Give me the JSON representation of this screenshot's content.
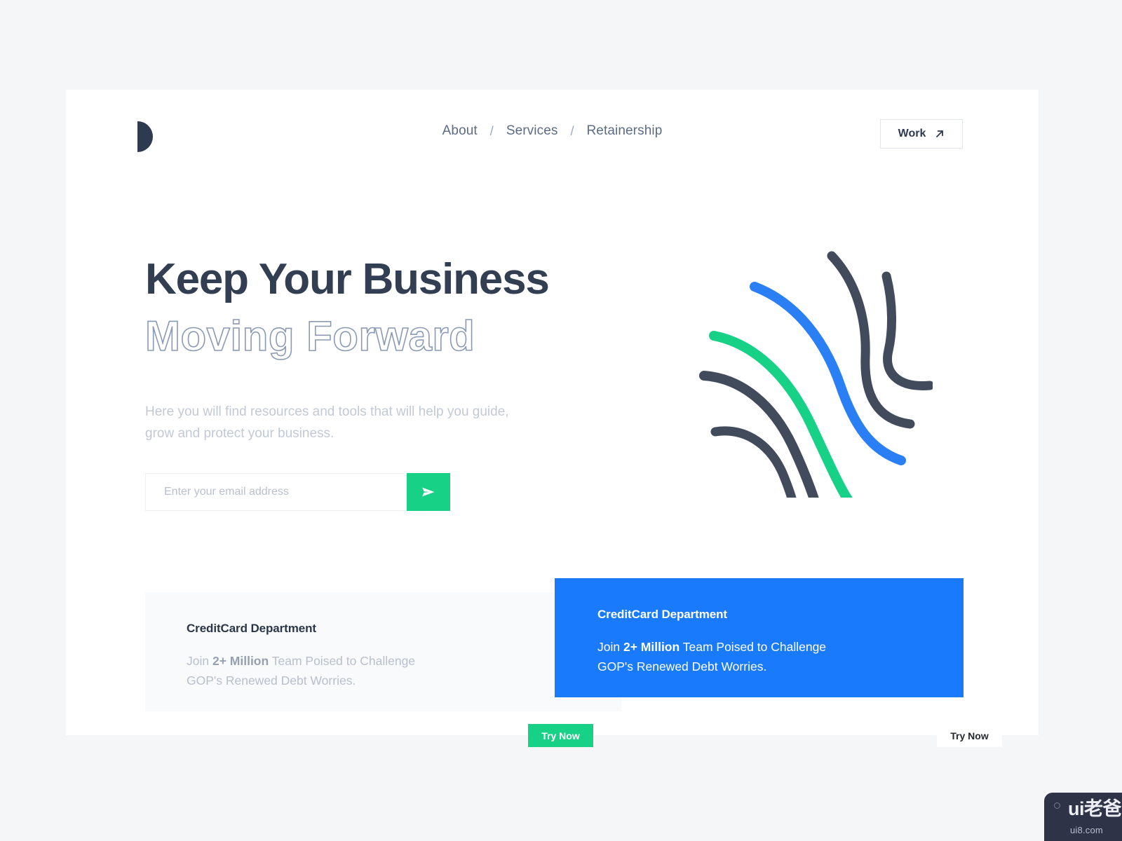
{
  "page": {
    "background_color": "#f4f6f8",
    "canvas_color": "#ffffff"
  },
  "header": {
    "logo_name": "half-circle-d-logo",
    "nav": [
      {
        "label": "About"
      },
      {
        "label": "Services"
      },
      {
        "label": "Retainership"
      }
    ],
    "separator": "/",
    "work_button": {
      "label": "Work",
      "icon": "arrow-up-right-icon"
    }
  },
  "hero": {
    "title_solid": "Keep Your Business",
    "title_outline": "Moving Forward",
    "subtitle": "Here you will find resources and tools that will help you guide, grow and protect your business.",
    "illustration_name": "brush-stroke-swirl-illustration"
  },
  "subscribe": {
    "placeholder": "Enter your email address",
    "value": "",
    "send_icon": "paper-plane-send-icon"
  },
  "cards": [
    {
      "variant": "light",
      "title": "CreditCard Department",
      "body_lead": "Join ",
      "body_strong": "2+ Million",
      "body_rest": " Team Poised to Challenge GOP's Renewed Debt Worries.",
      "button_label": "Try Now"
    },
    {
      "variant": "blue",
      "title": "CreditCard Department",
      "body_lead": "Join ",
      "body_strong": "2+ Million",
      "body_rest": " Team Poised to Challenge GOP's Renewed Debt Worries.",
      "button_label": "Try Now"
    }
  ],
  "colors": {
    "accent_green": "#16d186",
    "accent_blue": "#1a7afc",
    "heading_navy": "#323e52",
    "outline_slate": "#8b9ab4",
    "muted_gray": "#c2c9d6",
    "nav_slate": "#5c6b86",
    "stroke_dark": "#424b5c",
    "stroke_green": "#16d186",
    "stroke_blue": "#2b7ff5"
  },
  "watermark": {
    "main": "ui老爸",
    "sub": "ui8.com",
    "dot": "circle-dot-icon"
  }
}
